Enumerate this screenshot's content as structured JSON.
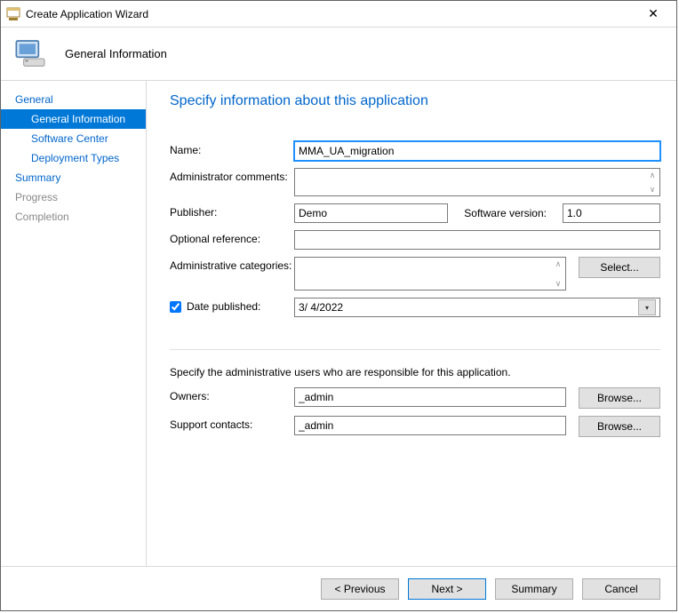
{
  "window": {
    "title": "Create Application Wizard"
  },
  "header": {
    "section": "General Information"
  },
  "sidebar": {
    "items": [
      {
        "label": "General",
        "sub": false,
        "state": "link"
      },
      {
        "label": "General Information",
        "sub": true,
        "state": "selected"
      },
      {
        "label": "Software Center",
        "sub": true,
        "state": "link"
      },
      {
        "label": "Deployment Types",
        "sub": true,
        "state": "link"
      },
      {
        "label": "Summary",
        "sub": false,
        "state": "link"
      },
      {
        "label": "Progress",
        "sub": false,
        "state": "disabled"
      },
      {
        "label": "Completion",
        "sub": false,
        "state": "disabled"
      }
    ]
  },
  "main": {
    "heading": "Specify information about this application",
    "labels": {
      "name": "Name:",
      "admin_comments": "Administrator comments:",
      "publisher": "Publisher:",
      "software_version": "Software version:",
      "optional_reference": "Optional reference:",
      "admin_categories": "Administrative categories:",
      "date_published": "Date published:",
      "note": "Specify the administrative users who are responsible for this application.",
      "owners": "Owners:",
      "support_contacts": "Support contacts:"
    },
    "values": {
      "name": "MMA_UA_migration",
      "admin_comments": "",
      "publisher": "Demo",
      "software_version": "1.0",
      "optional_reference": "",
      "admin_categories": "",
      "date_published_checked": true,
      "date_published": "3/  4/2022",
      "owners": "_admin",
      "support_contacts": "_admin"
    },
    "buttons": {
      "select": "Select...",
      "browse": "Browse..."
    }
  },
  "footer": {
    "previous": "<  Previous",
    "next": "Next  >",
    "summary": "Summary",
    "cancel": "Cancel"
  }
}
